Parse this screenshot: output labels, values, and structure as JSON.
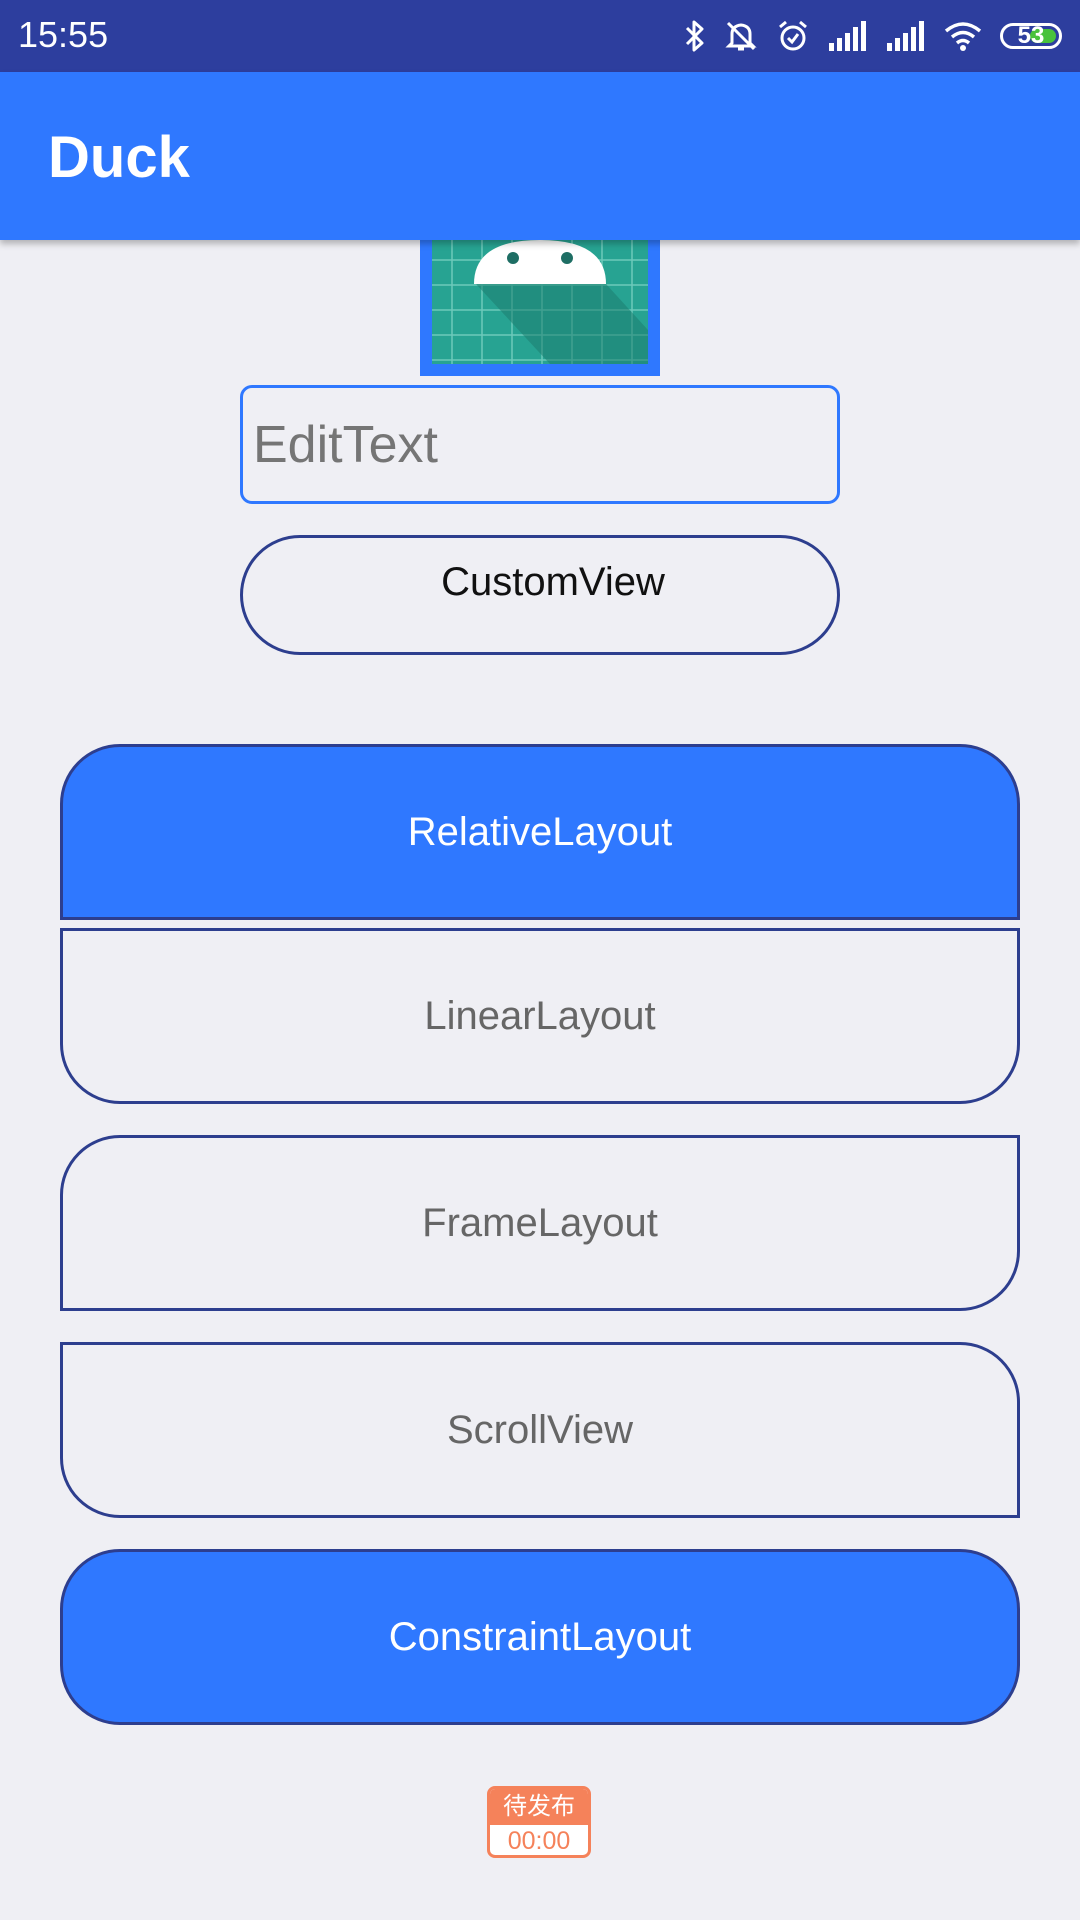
{
  "status_bar": {
    "time": "15:55",
    "battery_level": "53",
    "icons": [
      "bluetooth-icon",
      "mute-icon",
      "alarm-icon",
      "signal-icon",
      "signal-icon",
      "wifi-icon",
      "battery-icon"
    ]
  },
  "app_bar": {
    "title": "Duck"
  },
  "form": {
    "edittext_placeholder": "EditText",
    "customview_label": "CustomView"
  },
  "buttons": {
    "relative": "RelativeLayout",
    "linear": "LinearLayout",
    "frame": "FrameLayout",
    "scroll": "ScrollView",
    "constraint": "ConstraintLayout"
  },
  "badge": {
    "label": "待发布",
    "time": "00:00"
  },
  "colors": {
    "status_bar": "#2d3e9e",
    "accent": "#2f78ff",
    "border": "#2d3e8e",
    "background": "#efeff4",
    "badge": "#f5825a",
    "battery": "#49c23c"
  }
}
